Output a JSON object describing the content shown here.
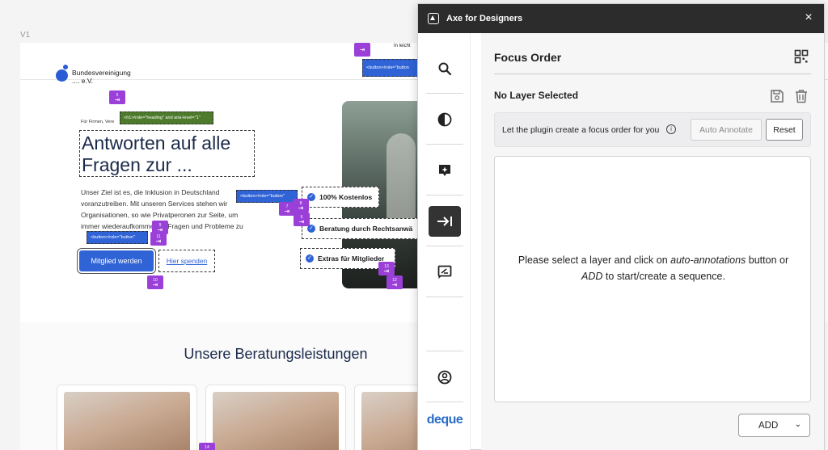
{
  "canvas": {
    "frame_label": "V1",
    "site": {
      "logo_text_line1": "Bundesvereinigung",
      "logo_text_line2": ".... e.V.",
      "hero_kicker": "Für Firmen, Vere",
      "hero_title": "Antworten auf alle Fragen zur ...",
      "hero_body": "Unser Ziel ist es, die Inklusion in Deutschland voranzutreiben. Mit unseren Services stehen wir Organisationen, so wie Privatperonen zur Seite, um immer wiederaufkommende Fragen und Probleme zu",
      "btn_member": "Mitglied werden",
      "link_donate": "Hier spenden",
      "features": [
        "100% Kostenlos",
        "Beratung durch Rechtsanwä",
        "Extras für Mitglieder"
      ],
      "section_title": "Unsere Beratungsleistungen"
    },
    "annotations": {
      "heading_tag": "<h1>/role=\"heading\" and aria-level=\"1\"",
      "button_tag_1": "<button>/role=\"button\"",
      "button_tag_2": "<button>/role=\"button\"",
      "button_tag_3": "<button>/role=\"button",
      "top_tag": "In leicht",
      "tab_numbers": [
        "5",
        "9",
        "11",
        "10",
        "8",
        "7",
        "6",
        "13",
        "12",
        "14"
      ]
    }
  },
  "plugin": {
    "title": "Axe for Designers",
    "close_label": "×",
    "panel_title": "Focus Order",
    "no_layer": "No Layer Selected",
    "auto_row_label": "Let the plugin create a focus order for you",
    "info_glyph": "i",
    "btn_auto": "Auto Annotate",
    "btn_reset": "Reset",
    "empty_msg_part1": "Please select a layer and click on ",
    "empty_msg_em1": "auto-annotations",
    "empty_msg_part2": " button or ",
    "empty_msg_em2": "ADD",
    "empty_msg_part3": " to start/create a sequence.",
    "btn_add": "ADD",
    "brand": "deque",
    "rail_icons": [
      "search-icon",
      "contrast-icon",
      "sparkle-icon",
      "focus-order-icon",
      "alt-text-icon",
      "profile-icon"
    ]
  }
}
